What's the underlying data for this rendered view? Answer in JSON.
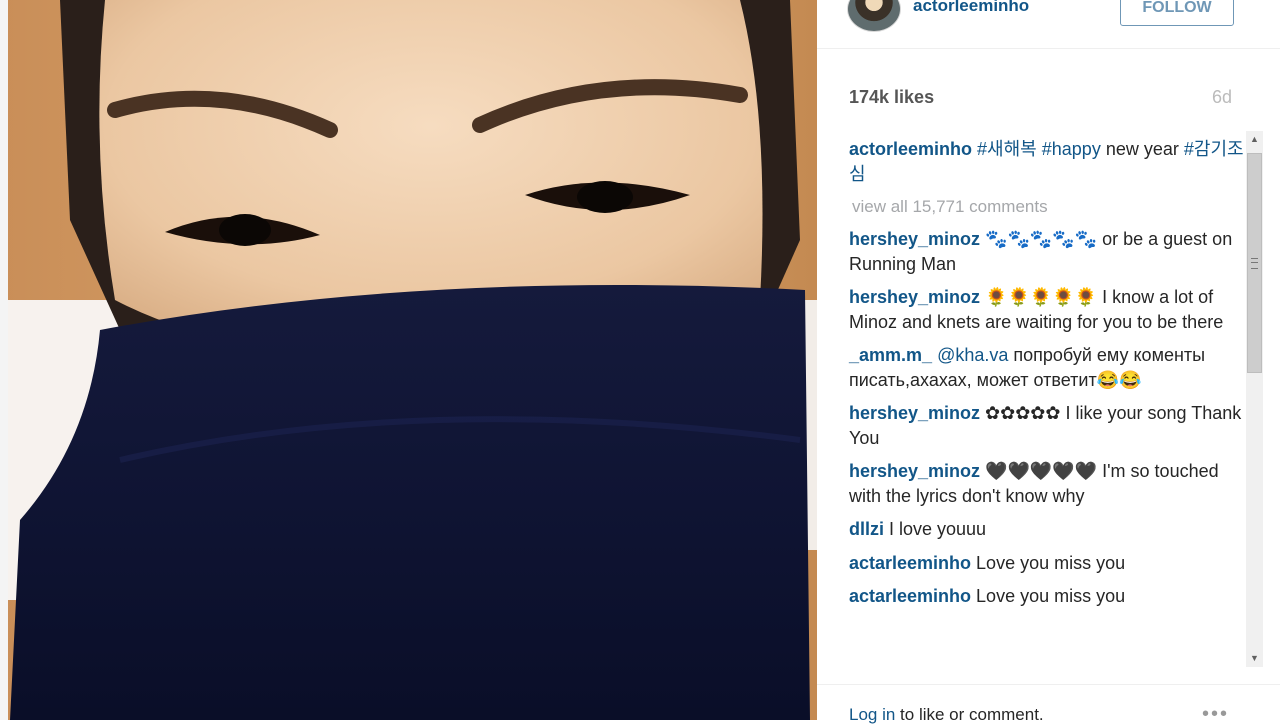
{
  "post": {
    "username": "actorleeminho",
    "follow_label": "FOLLOW",
    "likes": "174k likes",
    "age": "6d"
  },
  "caption": {
    "user": "actorleeminho",
    "tag1": "#새해복",
    "tag2": "#happy",
    "text1": " new year ",
    "tag3": "#감기조심"
  },
  "view_all": "view all 15,771 comments",
  "comments": [
    {
      "user": "hershey_minoz",
      "text": " 🐾🐾🐾🐾🐾 or be a guest on Running Man"
    },
    {
      "user": "hershey_minoz",
      "text": " 🌻🌻🌻🌻🌻 I know a lot of Minoz and knets are waiting for you to be there"
    },
    {
      "user": "_amm.m_",
      "mention": "@kha.va",
      "text": " попробуй ему коменты писать,ахахах, может ответит😂😂"
    },
    {
      "user": "hershey_minoz",
      "text": " ✿✿✿✿✿ I like your song Thank You"
    },
    {
      "user": "hershey_minoz",
      "text": " 🖤🖤🖤🖤🖤 I'm so touched with the lyrics don't know why"
    },
    {
      "user": "dllzi",
      "text": " I love youuu"
    },
    {
      "user": "actarleeminho",
      "text": " Love you miss you"
    },
    {
      "user": "actarleeminho",
      "text": " Love you miss you"
    }
  ],
  "footer": {
    "login_link": "Log in",
    "login_text": " to like or comment.",
    "more": "•••"
  },
  "colors": {
    "link": "#125688",
    "follow": "#6f97b6",
    "muted": "#a5a7aa"
  }
}
